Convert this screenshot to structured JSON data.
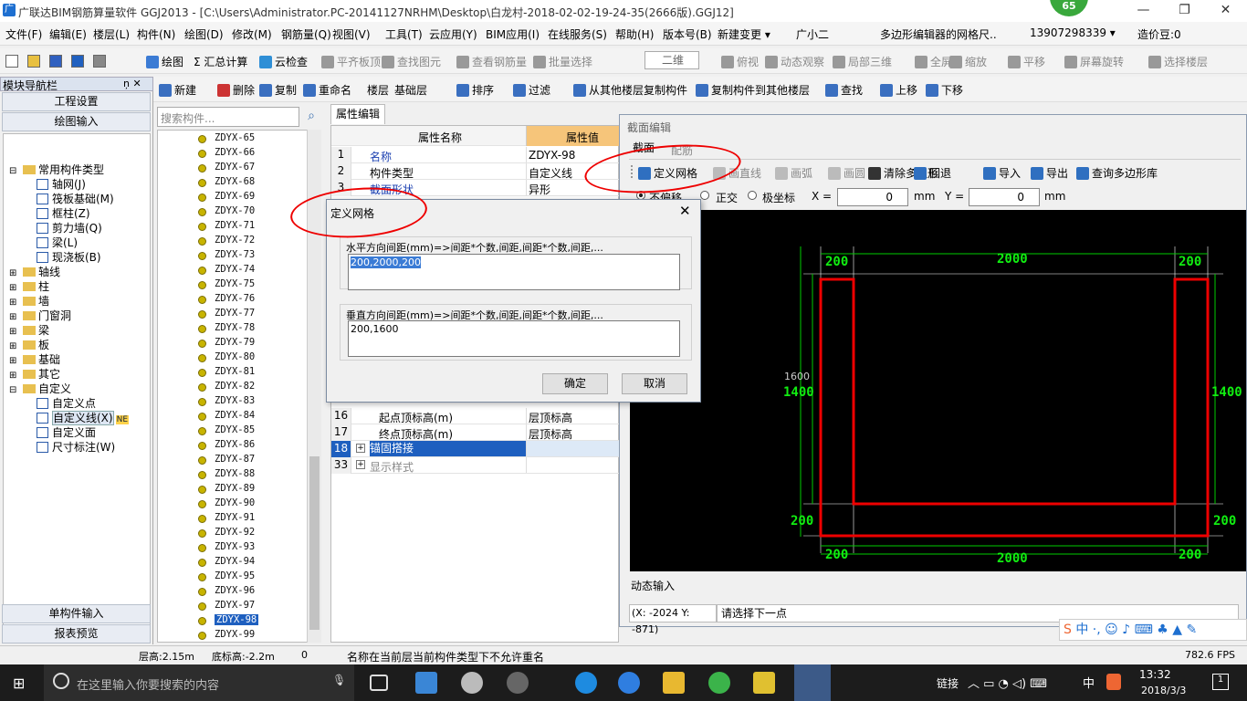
{
  "titlebar": {
    "app_icon": "广",
    "title": "广联达BIM钢筋算量软件 GGJ2013 - [C:\\Users\\Administrator.PC-20141127NRHM\\Desktop\\白龙村-2018-02-02-19-24-35(2666版).GGJ12]",
    "badge": "65"
  },
  "menu": [
    "文件(F)",
    "编辑(E)",
    "楼层(L)",
    "构件(N)",
    "绘图(D)",
    "修改(M)",
    "钢筋量(Q)",
    "视图(V)",
    "工具(T)",
    "云应用(Y)",
    "BIM应用(I)",
    "在线服务(S)",
    "帮助(H)",
    "版本号(B)",
    "新建变更 ▾",
    "广小二",
    "多边形编辑器的网格尺..",
    "13907298339 ▾",
    "造价豆:0"
  ],
  "toolbar1": [
    "绘图",
    "Σ 汇总计算",
    "云检查",
    "平齐板顶",
    "查找图元",
    "查看钢筋量",
    "批量选择",
    "二维",
    "俯视",
    "动态观察",
    "局部三维",
    "全屏",
    "缩放",
    "平移",
    "屏幕旋转",
    "选择楼层"
  ],
  "toolbar2": [
    "新建",
    "删除",
    "复制",
    "重命名",
    "楼层",
    "基础层",
    "排序",
    "过滤",
    "从其他楼层复制构件",
    "复制构件到其他楼层",
    "查找",
    "上移",
    "下移"
  ],
  "nav": {
    "title": "模块导航栏",
    "pin": "ņ x",
    "btn_project": "工程设置",
    "btn_draw": "绘图输入",
    "btn_single": "单构件输入",
    "btn_report": "报表预览",
    "tree": [
      {
        "label": "常用构件类型",
        "level": 0,
        "expand": "⊟"
      },
      {
        "label": "轴网(J)",
        "level": 1
      },
      {
        "label": "筏板基础(M)",
        "level": 1
      },
      {
        "label": "框柱(Z)",
        "level": 1
      },
      {
        "label": "剪力墙(Q)",
        "level": 1
      },
      {
        "label": "梁(L)",
        "level": 1
      },
      {
        "label": "现浇板(B)",
        "level": 1
      },
      {
        "label": "轴线",
        "level": 0,
        "expand": "⊞"
      },
      {
        "label": "柱",
        "level": 0,
        "expand": "⊞"
      },
      {
        "label": "墙",
        "level": 0,
        "expand": "⊞"
      },
      {
        "label": "门窗洞",
        "level": 0,
        "expand": "⊞"
      },
      {
        "label": "梁",
        "level": 0,
        "expand": "⊞"
      },
      {
        "label": "板",
        "level": 0,
        "expand": "⊞"
      },
      {
        "label": "基础",
        "level": 0,
        "expand": "⊞"
      },
      {
        "label": "其它",
        "level": 0,
        "expand": "⊞"
      },
      {
        "label": "自定义",
        "level": 0,
        "expand": "⊟"
      },
      {
        "label": "自定义点",
        "level": 1
      },
      {
        "label": "自定义线(X)",
        "level": 1,
        "selected": true,
        "new_badge": "NE"
      },
      {
        "label": "自定义面",
        "level": 1
      },
      {
        "label": "尺寸标注(W)",
        "level": 1
      }
    ]
  },
  "search": {
    "placeholder": "搜索构件..."
  },
  "components": [
    "ZDYX-65",
    "ZDYX-66",
    "ZDYX-67",
    "ZDYX-68",
    "ZDYX-69",
    "ZDYX-70",
    "ZDYX-71",
    "ZDYX-72",
    "ZDYX-73",
    "ZDYX-74",
    "ZDYX-75",
    "ZDYX-76",
    "ZDYX-77",
    "ZDYX-78",
    "ZDYX-79",
    "ZDYX-80",
    "ZDYX-81",
    "ZDYX-82",
    "ZDYX-83",
    "ZDYX-84",
    "ZDYX-85",
    "ZDYX-86",
    "ZDYX-87",
    "ZDYX-88",
    "ZDYX-89",
    "ZDYX-90",
    "ZDYX-91",
    "ZDYX-92",
    "ZDYX-93",
    "ZDYX-94",
    "ZDYX-95",
    "ZDYX-96",
    "ZDYX-97",
    "ZDYX-98",
    "ZDYX-99"
  ],
  "selected_component": "ZDYX-98",
  "props": {
    "tab": "属性编辑",
    "col_name": "属性名称",
    "col_value": "属性值",
    "rows": [
      {
        "no": "1",
        "name": "名称",
        "value": "ZDYX-98",
        "blue": true
      },
      {
        "no": "2",
        "name": "构件类型",
        "value": "自定义线"
      },
      {
        "no": "3",
        "name": "截面形状",
        "value": "异形",
        "blue": true
      },
      {
        "no": "16",
        "name": "起点顶标高(m)",
        "value": "层顶标高",
        "indent": true
      },
      {
        "no": "17",
        "name": "终点顶标高(m)",
        "value": "层顶标高",
        "indent": true
      },
      {
        "no": "18",
        "name": "锚固搭接",
        "value": "",
        "expand": "+",
        "selected": true
      },
      {
        "no": "33",
        "name": "显示样式",
        "value": "",
        "expand": "+",
        "gray": true
      }
    ]
  },
  "dialog": {
    "title": "定义网格",
    "h_label": "水平方向间距(mm)=>间距*个数,间距,间距*个数,间距,...",
    "h_value": "200,2000,200",
    "v_label": "垂直方向间距(mm)=>间距*个数,间距,间距*个数,间距,...",
    "v_value": "200,1600",
    "ok": "确定",
    "cancel": "取消"
  },
  "section": {
    "title": "截面编辑",
    "tabs": [
      "截面",
      "配筋"
    ],
    "tools": [
      "定义网格",
      "画直线",
      "画弧",
      "画圆",
      "清除多边形",
      "回退",
      "导入",
      "导出",
      "查询多边形库"
    ],
    "radio_labels": [
      "不偏移",
      "正交",
      "极坐标"
    ],
    "x_label": "X =",
    "x_value": "0",
    "y_label": "Y =",
    "y_value": "0",
    "unit": "mm",
    "dyn": "动态输入",
    "coord": "(X: -2024 Y: -871)",
    "prompt": "请选择下一点",
    "dims": {
      "top_left": "200",
      "top_mid": "2000",
      "top_right": "200",
      "left_small": "1600",
      "left_big": "1400",
      "right_big": "1400",
      "bl": "200",
      "br": "200",
      "bot_left": "200",
      "bot_mid": "2000",
      "bot_right": "200",
      "bot_mid2": "2000"
    }
  },
  "status": {
    "floor_height": "层高:2.15m",
    "bottom_elev": "底标高:-2.2m",
    "zero": "0",
    "msg": "名称在当前层当前构件类型下不允许重名",
    "fps": "782.6 FPS"
  },
  "taskbar": {
    "search_placeholder": "在这里输入你要搜索的内容",
    "link": "链接",
    "ime": "中",
    "time": "13:32",
    "date": "2018/3/3",
    "notify": "1"
  }
}
